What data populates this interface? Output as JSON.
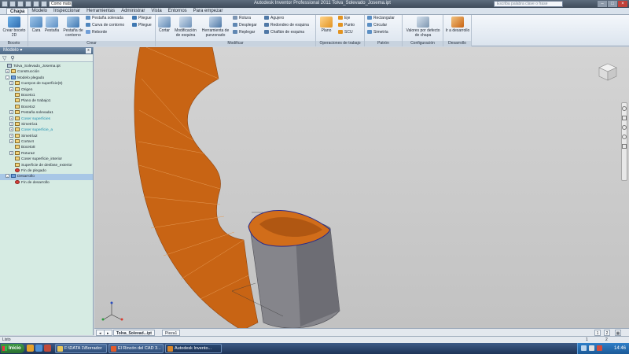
{
  "titlebar": {
    "project_combo": "Como mats",
    "title": "Autodesk Inventor Professional 2011   Tolva_Solevado_Josema.ipt",
    "search_placeholder": "Escriba palabra clave o frase"
  },
  "tabs": [
    "Chapa",
    "Modelo",
    "Inspeccionar",
    "Herramientas",
    "Administrar",
    "Vista",
    "Entornos",
    "Para empezar"
  ],
  "ribbon": {
    "boceto": {
      "label": "Boceto",
      "crear_boceto": "Crear boceto 2D"
    },
    "crear": {
      "label": "Crear",
      "cara": "Cara",
      "pestana": "Pestaña",
      "pestana_contorno": "Pestaña de contorno",
      "pestana_solevada": "Pestaña solevada",
      "curva_contorno": "Curva de contorno",
      "reborde": "Reborde",
      "pliegue1": "Pliegue",
      "pliegue2": "Pliegue"
    },
    "modificar": {
      "label": "Modificar",
      "cortar": "Cortar",
      "modificacion_esquina": "Modificación de esquina",
      "herramienta_punzonado": "Herramienta de punzonado",
      "rotura": "Rotura",
      "desplegar": "Desplegar",
      "replegar": "Replegar",
      "agujero": "Agujero",
      "redondeo_esquina": "Redondeo de esquina",
      "chaflan_esquina": "Chaflán de esquina"
    },
    "operaciones": {
      "label": "Operaciones de trabajo",
      "plano": "Plano",
      "eje": "Eje",
      "punto": "Punto",
      "scu": "SCU"
    },
    "patron": {
      "label": "Patrón",
      "rectangular": "Rectangular",
      "circular": "Circular",
      "simetria": "Simetría"
    },
    "configuracion": {
      "label": "Configuración",
      "valores": "Valores por defecto de chapa"
    },
    "desarrollo": {
      "label": "Desarrollo",
      "ir_desarrollo": "Ir a desarrollo"
    }
  },
  "browser": {
    "title": "Modelo",
    "close": "x",
    "filter_icon": "▽",
    "find_icon": "⚲",
    "tree": [
      {
        "label": "Tolva_Solevado_Josema.ipt",
        "indent": 0,
        "exp": "",
        "icon": "part"
      },
      {
        "label": "Construcción",
        "indent": 1,
        "exp": "+",
        "icon": "folder"
      },
      {
        "label": "Modelo plegado",
        "indent": 1,
        "exp": "-",
        "icon": "blue"
      },
      {
        "label": "Cuerpos de superficie(8)",
        "indent": 2,
        "exp": "+",
        "icon": "folder"
      },
      {
        "label": "Origen",
        "indent": 2,
        "exp": "+",
        "icon": "folder"
      },
      {
        "label": "Boceto1",
        "indent": 2,
        "exp": "",
        "icon": "folder"
      },
      {
        "label": "Plano de trabajo1",
        "indent": 2,
        "exp": "",
        "icon": "folder"
      },
      {
        "label": "Boceto2",
        "indent": 2,
        "exp": "",
        "icon": "folder"
      },
      {
        "label": "Pestaña solevada1",
        "indent": 2,
        "exp": "+",
        "icon": "folder"
      },
      {
        "label": "Coser superficies",
        "indent": 2,
        "exp": "+",
        "icon": "folder",
        "cyan": true
      },
      {
        "label": "Simetría1",
        "indent": 2,
        "exp": "+",
        "icon": "folder"
      },
      {
        "label": "Coser superficie_a",
        "indent": 2,
        "exp": "+",
        "icon": "folder",
        "cyan": true
      },
      {
        "label": "Simetría2",
        "indent": 2,
        "exp": "+",
        "icon": "folder"
      },
      {
        "label": "Cortar4",
        "indent": 2,
        "exp": "+",
        "icon": "folder"
      },
      {
        "label": "Boceto8",
        "indent": 2,
        "exp": "",
        "icon": "folder"
      },
      {
        "label": "Rotura2",
        "indent": 2,
        "exp": "+",
        "icon": "folder"
      },
      {
        "label": "Coser superficie_interior",
        "indent": 2,
        "exp": "",
        "icon": "folder"
      },
      {
        "label": "Superficie de desfase_exterior",
        "indent": 2,
        "exp": "",
        "icon": "folder"
      },
      {
        "label": "Fin de plegado",
        "indent": 2,
        "exp": "",
        "icon": "red"
      },
      {
        "label": "Desarrollo",
        "indent": 1,
        "exp": "-",
        "icon": "blue",
        "hl": true
      },
      {
        "label": "Fin de desarrollo",
        "indent": 2,
        "exp": "",
        "icon": "red"
      }
    ]
  },
  "viewcube": {
    "icon": "viewcube-icon"
  },
  "doctabs": [
    {
      "label": "Tolva_Solevad...ipt",
      "active": true
    },
    {
      "label": "Pieza1",
      "active": false
    }
  ],
  "pages": [
    "1",
    "2"
  ],
  "status": {
    "text": "Listo",
    "n1": "1",
    "n2": "2"
  },
  "taskbar": {
    "start": "Inicio",
    "items": [
      {
        "label": "F:\\DATA 1\\Borrador",
        "active": false
      },
      {
        "label": "El Rincón del CAD 3...",
        "active": false
      },
      {
        "label": "Autodesk Invento...",
        "active": true
      }
    ],
    "clock": "14:46"
  },
  "colors": {
    "sheet_orange": "#c86414",
    "sheet_dark": "#a14c0c",
    "cone_grey": "#7e7e84",
    "viewport_bg": "#cbcbcb"
  }
}
